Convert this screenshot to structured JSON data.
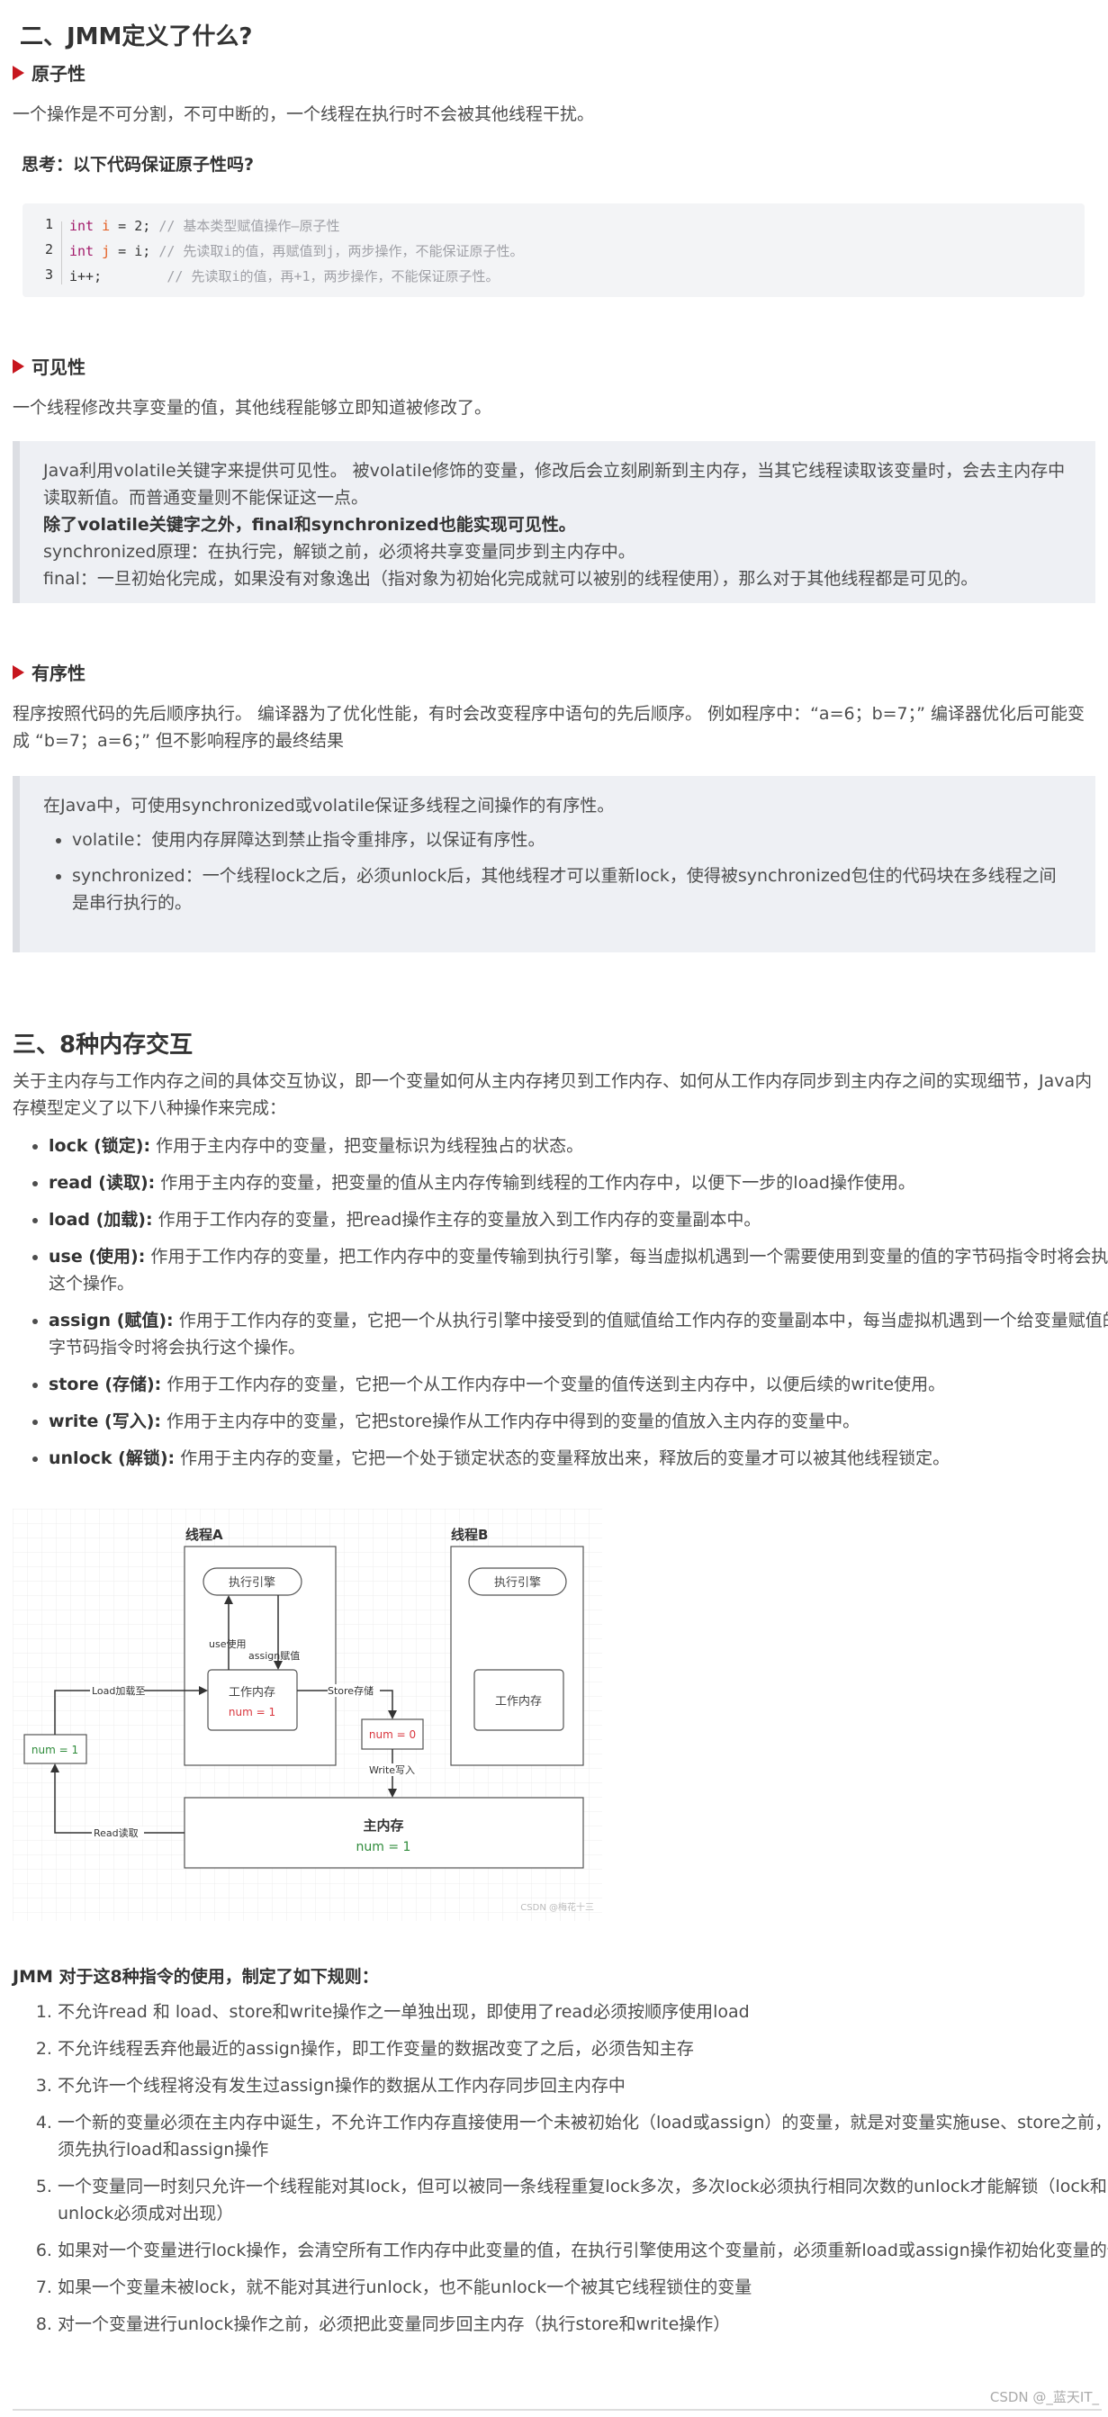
{
  "section2": {
    "title": "二、JMM定义了什么?",
    "atomicity": {
      "heading": "原子性",
      "desc": "一个操作是不可分割，不可中断的，一个线程在执行时不会被其他线程干扰。",
      "think": "思考：以下代码保证原子性吗?",
      "code": [
        {
          "num": "1",
          "kw": "int",
          "var": "i",
          "rest": " = 2; ",
          "comment": "// 基本类型赋值操作—原子性"
        },
        {
          "num": "2",
          "kw": "int",
          "var": "j",
          "rest": " = i; ",
          "comment": "// 先读取i的值，再赋值到j，两步操作，不能保证原子性。"
        },
        {
          "num": "3",
          "kw": "",
          "var": "",
          "rest": "i++;        ",
          "comment": "// 先读取i的值，再+1，两步操作，不能保证原子性。"
        }
      ]
    },
    "visibility": {
      "heading": "可见性",
      "desc": "一个线程修改共享变量的值，其他线程能够立即知道被修改了。",
      "quote": {
        "line1": "Java利用volatile关键字来提供可见性。 被volatile修饰的变量，修改后会立刻刷新到主内存，当其它线程读取该变量时，会去主内存中读取新值。而普通变量则不能保证这一点。",
        "bold": "除了volatile关键字之外，final和synchronized也能实现可见性。",
        "line3": "synchronized原理：在执行完，解锁之前，必须将共享变量同步到主内存中。",
        "line4": "final：一旦初始化完成，如果没有对象逸出（指对象为初始化完成就可以被别的线程使用），那么对于其他线程都是可见的。"
      }
    },
    "ordering": {
      "heading": "有序性",
      "desc": "程序按照代码的先后顺序执行。 编译器为了优化性能，有时会改变程序中语句的先后顺序。 例如程序中：“a=6；b=7；” 编译器优化后可能变成 “b=7；a=6；” 但不影响程序的最终结果",
      "quote": {
        "intro": "在Java中，可使用synchronized或volatile保证多线程之间操作的有序性。",
        "items": [
          "volatile：使用内存屏障达到禁止指令重排序，以保证有序性。",
          "synchronized：一个线程lock之后，必须unlock后，其他线程才可以重新lock，使得被synchronized包住的代码块在多线程之间是串行执行的。"
        ]
      }
    }
  },
  "section3": {
    "title": "三、8种内存交互",
    "intro": "关于主内存与工作内存之间的具体交互协议，即一个变量如何从主内存拷贝到工作内存、如何从工作内存同步到主内存之间的实现细节，Java内存模型定义了以下八种操作来完成：",
    "ops": [
      {
        "name": "lock (锁定):",
        "desc": " 作用于主内存中的变量，把变量标识为线程独占的状态。"
      },
      {
        "name": "read (读取):",
        "desc": " 作用于主内存的变量，把变量的值从主内存传输到线程的工作内存中，以便下一步的load操作使用。"
      },
      {
        "name": "load (加载):",
        "desc": " 作用于工作内存的变量，把read操作主存的变量放入到工作内存的变量副本中。"
      },
      {
        "name": "use (使用):",
        "desc": " 作用于工作内存的变量，把工作内存中的变量传输到执行引擎，每当虚拟机遇到一个需要使用到变量的值的字节码指令时将会执行这个操作。"
      },
      {
        "name": "assign (赋值):",
        "desc": " 作用于工作内存的变量，它把一个从执行引擎中接受到的值赋值给工作内存的变量副本中，每当虚拟机遇到一个给变量赋值的字节码指令时将会执行这个操作。"
      },
      {
        "name": "store (存储):",
        "desc": " 作用于工作内存的变量，它把一个从工作内存中一个变量的值传送到主内存中，以便后续的write使用。"
      },
      {
        "name": "write (写入):",
        "desc": " 作用于主内存中的变量，它把store操作从工作内存中得到的变量的值放入主内存的变量中。"
      },
      {
        "name": "unlock (解锁):",
        "desc": " 作用于主内存的变量，它把一个处于锁定状态的变量释放出来，释放后的变量才可以被其他线程锁定。"
      }
    ],
    "diagram": {
      "threadA": "线程A",
      "threadB": "线程B",
      "engine": "执行引擎",
      "working_memory": "工作内存",
      "working_value": "num = 1",
      "use_label": "use使用",
      "assign_label": "assign赋值",
      "load_label": "Load加载至",
      "store_label": "Store存储",
      "write_label": "Write写入",
      "read_label": "Read读取",
      "read_box_value": "num = 1",
      "store_box_value": "num = 0",
      "main_memory": "主内存",
      "main_value": "num = 1",
      "watermark": "CSDN @梅花十三",
      "colors": {
        "red": "#d9363e",
        "green": "#2e8b3a"
      }
    },
    "rules_title": "JMM 对于这8种指令的使用，制定了如下规则：",
    "rules": [
      "不允许read 和 load、store和write操作之一单独出现，即使用了read必须按顺序使用load",
      "不允许线程丢弃他最近的assign操作，即工作变量的数据改变了之后，必须告知主存",
      "不允许一个线程将没有发生过assign操作的数据从工作内存同步回主内存中",
      "一个新的变量必须在主内存中诞生，不允许工作内存直接使用一个未被初始化（load或assign）的变量，就是对变量实施use、store之前，必须先执行load和assign操作",
      "一个变量同一时刻只允许一个线程能对其lock，但可以被同一条线程重复lock多次，多次lock必须执行相同次数的unlock才能解锁（lock和unlock必须成对出现）",
      "如果对一个变量进行lock操作，会清空所有工作内存中此变量的值，在执行引擎使用这个变量前，必须重新load或assign操作初始化变量的值",
      "如果一个变量未被lock，就不能对其进行unlock，也不能unlock一个被其它线程锁住的变量",
      "对一个变量进行unlock操作之前，必须把此变量同步回主内存（执行store和write操作）"
    ]
  },
  "footer": {
    "watermark": "CSDN @_蓝天IT_"
  }
}
